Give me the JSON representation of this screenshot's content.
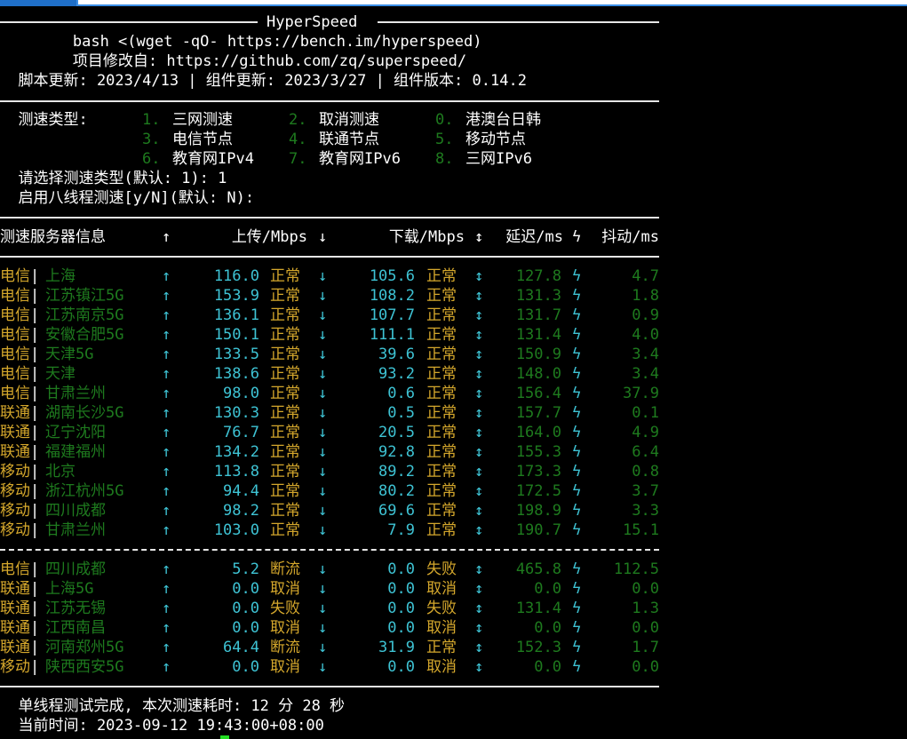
{
  "title": "HyperSpeed",
  "header_lines": [
    "        bash <(wget -qO- https://bench.im/hyperspeed)",
    "        项目修改自: https://github.com/zq/superspeed/",
    "  脚本更新: 2023/4/13 | 组件更新: 2023/3/27 | 组件版本: 0.14.2"
  ],
  "menu": {
    "label": "  测速类型:",
    "rows": [
      [
        {
          "num": "1.",
          "name": "三网测速"
        },
        {
          "num": "2.",
          "name": "取消测速"
        },
        {
          "num": "0.",
          "name": "港澳台日韩"
        }
      ],
      [
        {
          "num": "3.",
          "name": "电信节点"
        },
        {
          "num": "4.",
          "name": "联通节点"
        },
        {
          "num": "5.",
          "name": "移动节点"
        }
      ],
      [
        {
          "num": "6.",
          "name": "教育网IPv4"
        },
        {
          "num": "7.",
          "name": "教育网IPv6"
        },
        {
          "num": "8.",
          "name": "三网IPv6"
        }
      ]
    ],
    "prompt1": "  请选择测速类型(默认: 1): 1",
    "prompt2": "  启用八线程测速[y/N](默认: N):"
  },
  "table_header": {
    "server": "测速服务器信息",
    "up_arrow": "↑",
    "upload": "上传/Mbps",
    "down_arrow": "↓",
    "download": "下载/Mbps",
    "updown": "↕",
    "latency": "延迟/ms",
    "bolt": "ϟ",
    "jitter": "抖动/ms"
  },
  "rows_ok": [
    {
      "isp": "电信",
      "node": "上海",
      "up": "116.0",
      "up_status": "正常",
      "down": "105.6",
      "down_status": "正常",
      "latency": "127.8",
      "jitter": "4.7"
    },
    {
      "isp": "电信",
      "node": "江苏镇江5G",
      "up": "153.9",
      "up_status": "正常",
      "down": "108.2",
      "down_status": "正常",
      "latency": "131.3",
      "jitter": "1.8"
    },
    {
      "isp": "电信",
      "node": "江苏南京5G",
      "up": "136.1",
      "up_status": "正常",
      "down": "107.7",
      "down_status": "正常",
      "latency": "131.7",
      "jitter": "0.9"
    },
    {
      "isp": "电信",
      "node": "安徽合肥5G",
      "up": "150.1",
      "up_status": "正常",
      "down": "111.1",
      "down_status": "正常",
      "latency": "131.4",
      "jitter": "4.0"
    },
    {
      "isp": "电信",
      "node": "天津5G",
      "up": "133.5",
      "up_status": "正常",
      "down": "39.6",
      "down_status": "正常",
      "latency": "150.9",
      "jitter": "3.4"
    },
    {
      "isp": "电信",
      "node": "天津",
      "up": "138.6",
      "up_status": "正常",
      "down": "93.2",
      "down_status": "正常",
      "latency": "148.0",
      "jitter": "3.4"
    },
    {
      "isp": "电信",
      "node": "甘肃兰州",
      "up": "98.0",
      "up_status": "正常",
      "down": "0.6",
      "down_status": "正常",
      "latency": "156.4",
      "jitter": "37.9"
    },
    {
      "isp": "联通",
      "node": "湖南长沙5G",
      "up": "130.3",
      "up_status": "正常",
      "down": "0.5",
      "down_status": "正常",
      "latency": "157.7",
      "jitter": "0.1"
    },
    {
      "isp": "联通",
      "node": "辽宁沈阳",
      "up": "76.7",
      "up_status": "正常",
      "down": "20.5",
      "down_status": "正常",
      "latency": "164.0",
      "jitter": "4.9"
    },
    {
      "isp": "联通",
      "node": "福建福州",
      "up": "134.2",
      "up_status": "正常",
      "down": "92.8",
      "down_status": "正常",
      "latency": "155.3",
      "jitter": "6.4"
    },
    {
      "isp": "移动",
      "node": "北京",
      "up": "113.8",
      "up_status": "正常",
      "down": "89.2",
      "down_status": "正常",
      "latency": "173.3",
      "jitter": "0.8"
    },
    {
      "isp": "移动",
      "node": "浙江杭州5G",
      "up": "94.4",
      "up_status": "正常",
      "down": "80.2",
      "down_status": "正常",
      "latency": "172.5",
      "jitter": "3.7"
    },
    {
      "isp": "移动",
      "node": "四川成都",
      "up": "98.2",
      "up_status": "正常",
      "down": "69.6",
      "down_status": "正常",
      "latency": "198.9",
      "jitter": "3.3"
    },
    {
      "isp": "移动",
      "node": "甘肃兰州",
      "up": "103.0",
      "up_status": "正常",
      "down": "7.9",
      "down_status": "正常",
      "latency": "190.7",
      "jitter": "15.1"
    }
  ],
  "rows_fail": [
    {
      "isp": "电信",
      "node": "四川成都",
      "up": "5.2",
      "up_status": "断流",
      "down": "0.0",
      "down_status": "失败",
      "latency": "465.8",
      "jitter": "112.5"
    },
    {
      "isp": "联通",
      "node": "上海5G",
      "up": "0.0",
      "up_status": "取消",
      "down": "0.0",
      "down_status": "取消",
      "latency": "0.0",
      "jitter": "0.0"
    },
    {
      "isp": "联通",
      "node": "江苏无锡",
      "up": "0.0",
      "up_status": "失败",
      "down": "0.0",
      "down_status": "失败",
      "latency": "131.4",
      "jitter": "1.3"
    },
    {
      "isp": "联通",
      "node": "江西南昌",
      "up": "0.0",
      "up_status": "取消",
      "down": "0.0",
      "down_status": "取消",
      "latency": "0.0",
      "jitter": "0.0"
    },
    {
      "isp": "联通",
      "node": "河南郑州5G",
      "up": "64.4",
      "up_status": "断流",
      "down": "31.9",
      "down_status": "正常",
      "latency": "152.3",
      "jitter": "1.7"
    },
    {
      "isp": "移动",
      "node": "陕西西安5G",
      "up": "0.0",
      "up_status": "取消",
      "down": "0.0",
      "down_status": "取消",
      "latency": "0.0",
      "jitter": "0.0"
    }
  ],
  "footer": {
    "done": "  单线程测试完成, 本次测速耗时: 12 分 28 秒",
    "time": "  当前时间: 2023-09-12 19:43:00+08:00"
  },
  "colors": {
    "background": "#000000",
    "text": "#ffffff",
    "green": "#2aa52a",
    "cyan": "#3ec3d4",
    "yellow": "#d4a72c",
    "cursor": "#22dd22"
  }
}
